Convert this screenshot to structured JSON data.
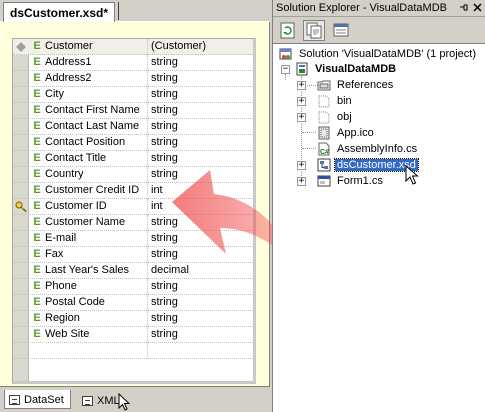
{
  "designer": {
    "tab_title": "dsCustomer.xsd*",
    "element": {
      "header": {
        "name": "Customer",
        "type": "(Customer)"
      },
      "rows": [
        {
          "name": "Address1",
          "type": "string",
          "kind": "E",
          "key": false
        },
        {
          "name": "Address2",
          "type": "string",
          "kind": "E",
          "key": false
        },
        {
          "name": "City",
          "type": "string",
          "kind": "E",
          "key": false
        },
        {
          "name": "Contact First Name",
          "type": "string",
          "kind": "E",
          "key": false
        },
        {
          "name": "Contact Last Name",
          "type": "string",
          "kind": "E",
          "key": false
        },
        {
          "name": "Contact Position",
          "type": "string",
          "kind": "E",
          "key": false
        },
        {
          "name": "Contact Title",
          "type": "string",
          "kind": "E",
          "key": false
        },
        {
          "name": "Country",
          "type": "string",
          "kind": "E",
          "key": false
        },
        {
          "name": "Customer Credit ID",
          "type": "int",
          "kind": "E",
          "key": false
        },
        {
          "name": "Customer ID",
          "type": "int",
          "kind": "E",
          "key": true
        },
        {
          "name": "Customer Name",
          "type": "string",
          "kind": "E",
          "key": false
        },
        {
          "name": "E-mail",
          "type": "string",
          "kind": "E",
          "key": false
        },
        {
          "name": "Fax",
          "type": "string",
          "kind": "E",
          "key": false
        },
        {
          "name": "Last Year's Sales",
          "type": "decimal",
          "kind": "E",
          "key": false
        },
        {
          "name": "Phone",
          "type": "string",
          "kind": "E",
          "key": false
        },
        {
          "name": "Postal Code",
          "type": "string",
          "kind": "E",
          "key": false
        },
        {
          "name": "Region",
          "type": "string",
          "kind": "E",
          "key": false
        },
        {
          "name": "Web Site",
          "type": "string",
          "kind": "E",
          "key": false
        }
      ]
    },
    "view_tabs": [
      {
        "label": "DataSet",
        "active": true
      },
      {
        "label": "XML",
        "active": false
      }
    ]
  },
  "solution_explorer": {
    "title": "Solution Explorer - VisualDataMDB",
    "title_controls": [
      "pin-icon",
      "close-icon"
    ],
    "toolbar": [
      "refresh-icon",
      "show-all-files-icon",
      "properties-icon"
    ],
    "tree": {
      "solution": "Solution 'VisualDataMDB' (1 project)",
      "project": "VisualDataMDB",
      "items": [
        {
          "label": "References",
          "icon": "references-folder-icon",
          "expandable": true
        },
        {
          "label": "bin",
          "icon": "folder-icon",
          "expandable": true
        },
        {
          "label": "obj",
          "icon": "folder-icon",
          "expandable": true
        },
        {
          "label": "App.ico",
          "icon": "icon-file-icon",
          "expandable": false
        },
        {
          "label": "AssemblyInfo.cs",
          "icon": "csharp-file-icon",
          "expandable": false
        },
        {
          "label": "dsCustomer.xsd",
          "icon": "xsd-file-icon",
          "expandable": true,
          "selected": true
        },
        {
          "label": "Form1.cs",
          "icon": "form-file-icon",
          "expandable": true
        }
      ]
    }
  },
  "colors": {
    "canvas_bg": "#ffffdc",
    "element_glyph": "#5c9c2c",
    "selection": "#316ac5",
    "arrow": "#f05050"
  }
}
